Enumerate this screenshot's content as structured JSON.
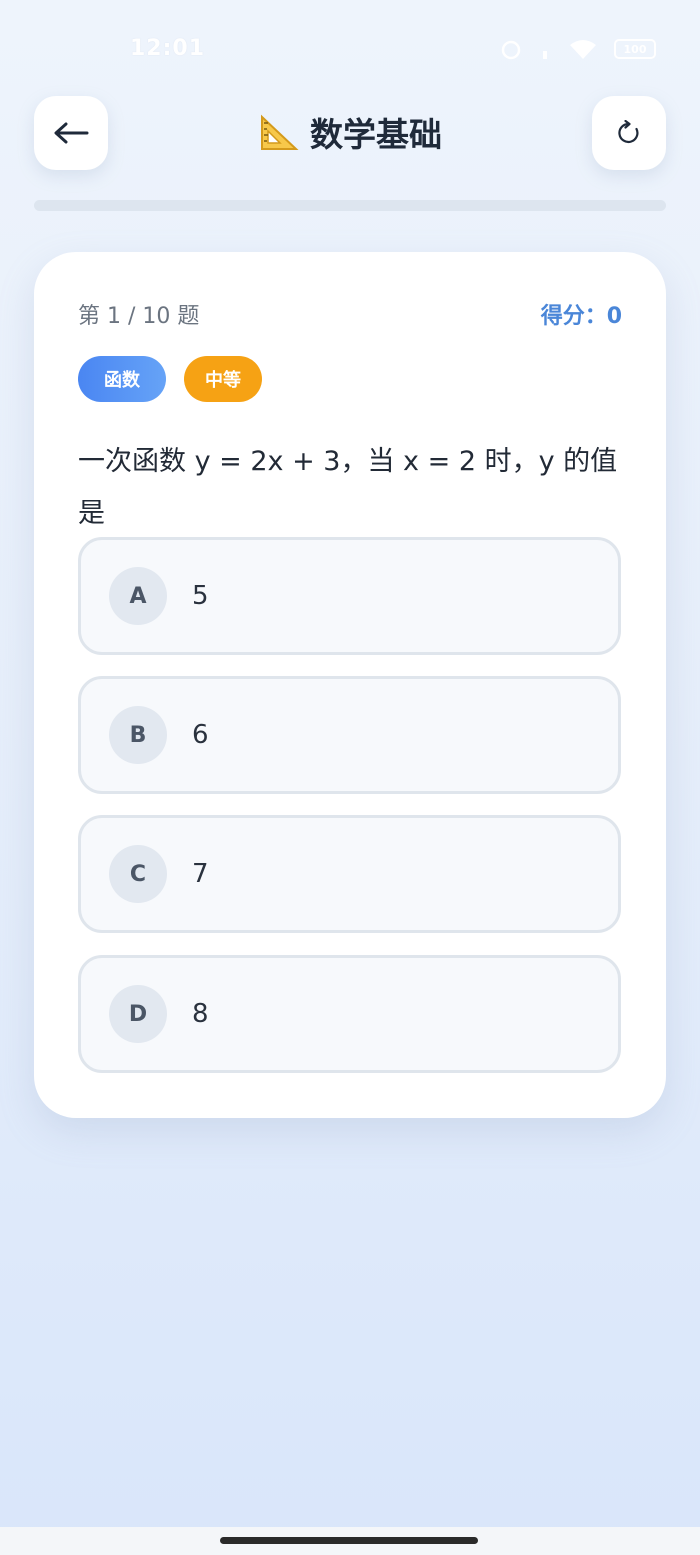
{
  "status_bar": {
    "time": "12:01",
    "battery": "100"
  },
  "header": {
    "title": "数学基础",
    "back_icon": "arrow-left-icon",
    "refresh_icon": "refresh-icon",
    "title_icon": "triangular-ruler-icon"
  },
  "progress": {
    "fraction": 0
  },
  "quiz": {
    "counter": "第 1 / 10 题",
    "score": "得分：0",
    "tag_topic": "函数",
    "tag_level": "中等",
    "question": "一次函数 y = 2x + 3，当 x = 2 时，y 的值是",
    "options": [
      {
        "letter": "A",
        "text": "5"
      },
      {
        "letter": "B",
        "text": "6"
      },
      {
        "letter": "C",
        "text": "7"
      },
      {
        "letter": "D",
        "text": "8"
      }
    ]
  },
  "colors": {
    "accent": "#4a86f2",
    "level_badge": "#f6a214",
    "score": "#4a86d8"
  }
}
